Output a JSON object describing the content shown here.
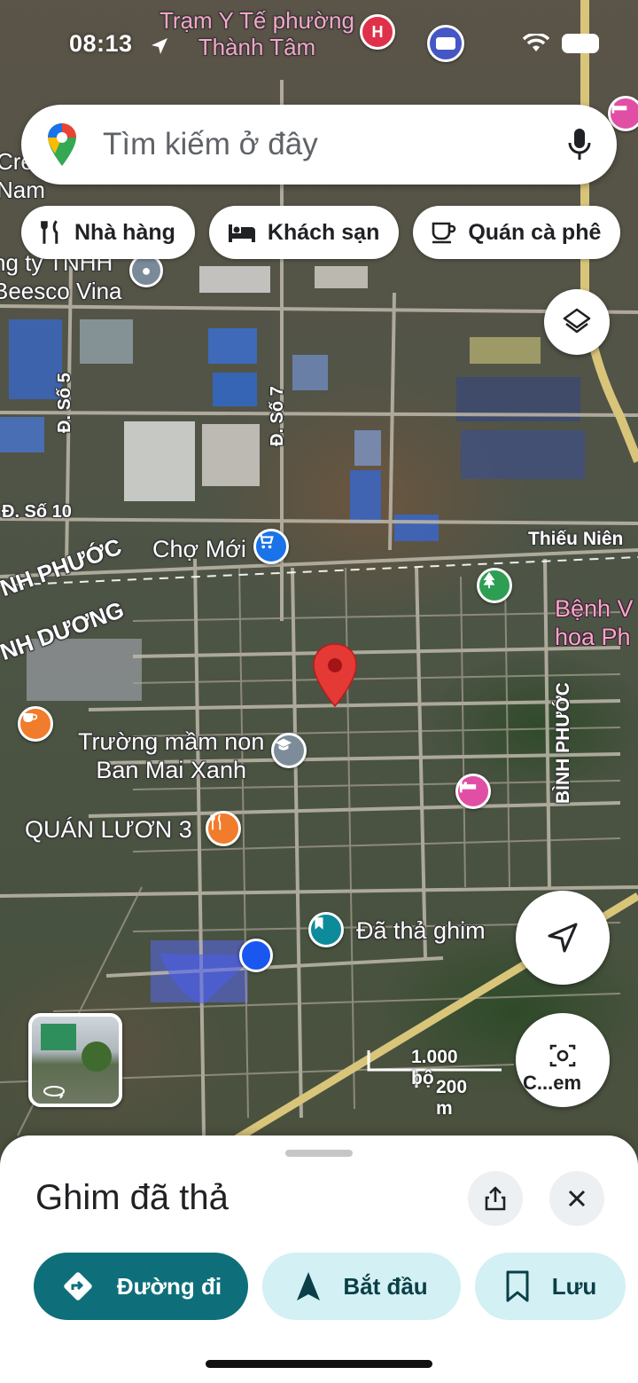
{
  "status_bar": {
    "time": "08:13"
  },
  "search": {
    "placeholder": "Tìm kiếm ở đây"
  },
  "chips": [
    {
      "label": "Nhà hàng",
      "icon": "fork-knife-icon"
    },
    {
      "label": "Khách sạn",
      "icon": "bed-icon"
    },
    {
      "label": "Quán cà phê",
      "icon": "coffee-cup-icon"
    }
  ],
  "map_labels": {
    "health_station": "Trạm Y Tế phường\nThành Tâm",
    "company_a": "Cre\nNam",
    "company_b": "ng ty TNHH\nBeesco Vina",
    "road_so5": "Đ. Số 5",
    "road_so7": "Đ. Số 7",
    "road_so10": "Đ. Số 10",
    "province_bp": "NH PHƯỚC",
    "province_bd": "NH DƯƠNG",
    "market": "Chợ Mới",
    "thieu_nien": "Thiếu Niên",
    "hospital": "Bệnh V\nhoa Ph",
    "road_binh_phuoc": "BÌNH PHƯỚC",
    "school": "Trường mầm non\nBan Mai Xanh",
    "restaurant": "QUÁN LƯƠN 3",
    "saved_pin": "Đã thả ghim",
    "scale_ft": "1.000 bộ",
    "scale_m": "200 m",
    "camera_label": "C...em"
  },
  "sheet": {
    "title": "Ghim đã thả",
    "actions": [
      {
        "label": "Đường đi",
        "icon": "directions-icon"
      },
      {
        "label": "Bắt đầu",
        "icon": "navigation-arrow-icon"
      },
      {
        "label": "Lưu",
        "icon": "bookmark-icon"
      }
    ]
  },
  "colors": {
    "primary_teal": "#0e6f7a",
    "light_teal": "#d3f0f4",
    "pin_red": "#e53935",
    "location_blue": "#1a56f0"
  }
}
